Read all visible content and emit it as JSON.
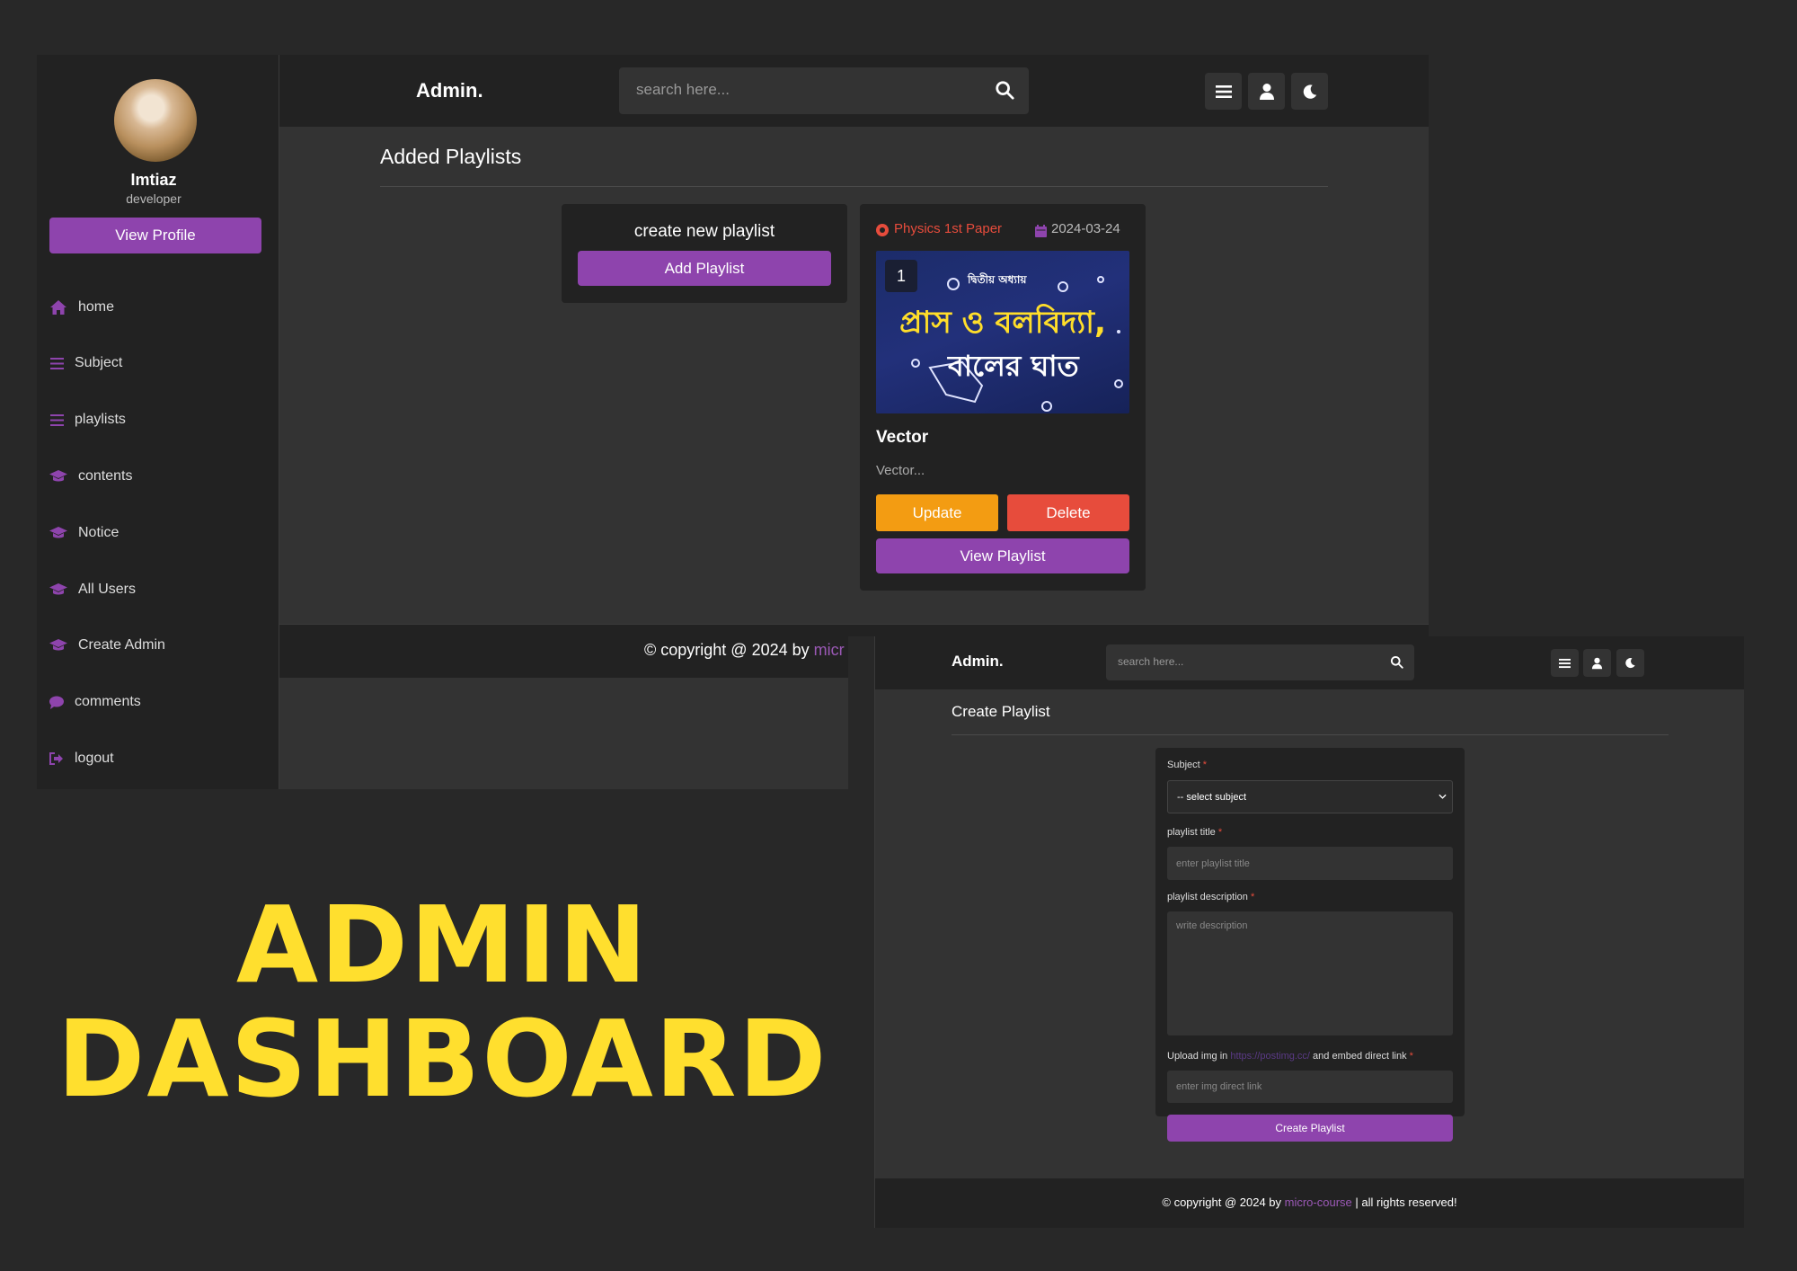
{
  "shot1": {
    "brand": "Admin.",
    "search_placeholder": "search here...",
    "user": {
      "name": "Imtiaz",
      "role": "developer",
      "view_profile": "View Profile"
    },
    "nav": [
      {
        "label": "home",
        "icon": "home-icon"
      },
      {
        "label": "Subject",
        "icon": "bars-icon"
      },
      {
        "label": "playlists",
        "icon": "bars-icon"
      },
      {
        "label": "contents",
        "icon": "graduation-cap-icon"
      },
      {
        "label": "Notice",
        "icon": "graduation-cap-icon"
      },
      {
        "label": "All Users",
        "icon": "graduation-cap-icon"
      },
      {
        "label": "Create Admin",
        "icon": "graduation-cap-icon"
      },
      {
        "label": "comments",
        "icon": "comment-icon"
      },
      {
        "label": "logout",
        "icon": "logout-icon"
      }
    ],
    "page_title": "Added Playlists",
    "create_card": {
      "title": "create new playlist",
      "button": "Add Playlist"
    },
    "playlist_card": {
      "subject": "Physics 1st Paper",
      "date": "2024-03-24",
      "thumb_count": "1",
      "thumb_caption_top": "দ্বিতীয় অধ্যায়",
      "thumb_caption_line1": "প্রাস ও বলবিদ্যা,",
      "thumb_caption_line2": "বালের ঘাত",
      "title": "Vector",
      "description": "Vector...",
      "update": "Update",
      "delete": "Delete",
      "view": "View Playlist"
    },
    "footer": {
      "prefix": "© copyright @ 2024 by",
      "brand": "micr"
    }
  },
  "shot2": {
    "brand": "Admin.",
    "search_placeholder": "search here...",
    "page_title": "Create Playlist",
    "form": {
      "subject_label": "Subject",
      "subject_value": "-- select subject",
      "title_label": "playlist title",
      "title_placeholder": "enter playlist title",
      "desc_label": "playlist description",
      "desc_placeholder": "write description",
      "img_label_prefix": "Upload img in",
      "img_link": "https://postimg.cc/",
      "img_label_suffix": "and embed direct link",
      "img_placeholder": "enter img direct link",
      "submit": "Create Playlist",
      "required_mark": "*"
    },
    "footer": {
      "prefix": "© copyright @ 2024 by",
      "brand": "micro-course",
      "suffix": "| all rights reserved!"
    }
  },
  "headline": {
    "line1": "ADMIN",
    "line2": "DASHBOARD"
  },
  "colors": {
    "accent": "#8e44ad",
    "accent_text": "#9b59b6",
    "warning": "#f39c12",
    "danger": "#e74c3c",
    "headline": "#ffdf2e",
    "bg": "#282828",
    "panel": "#222222",
    "main": "#333333"
  }
}
